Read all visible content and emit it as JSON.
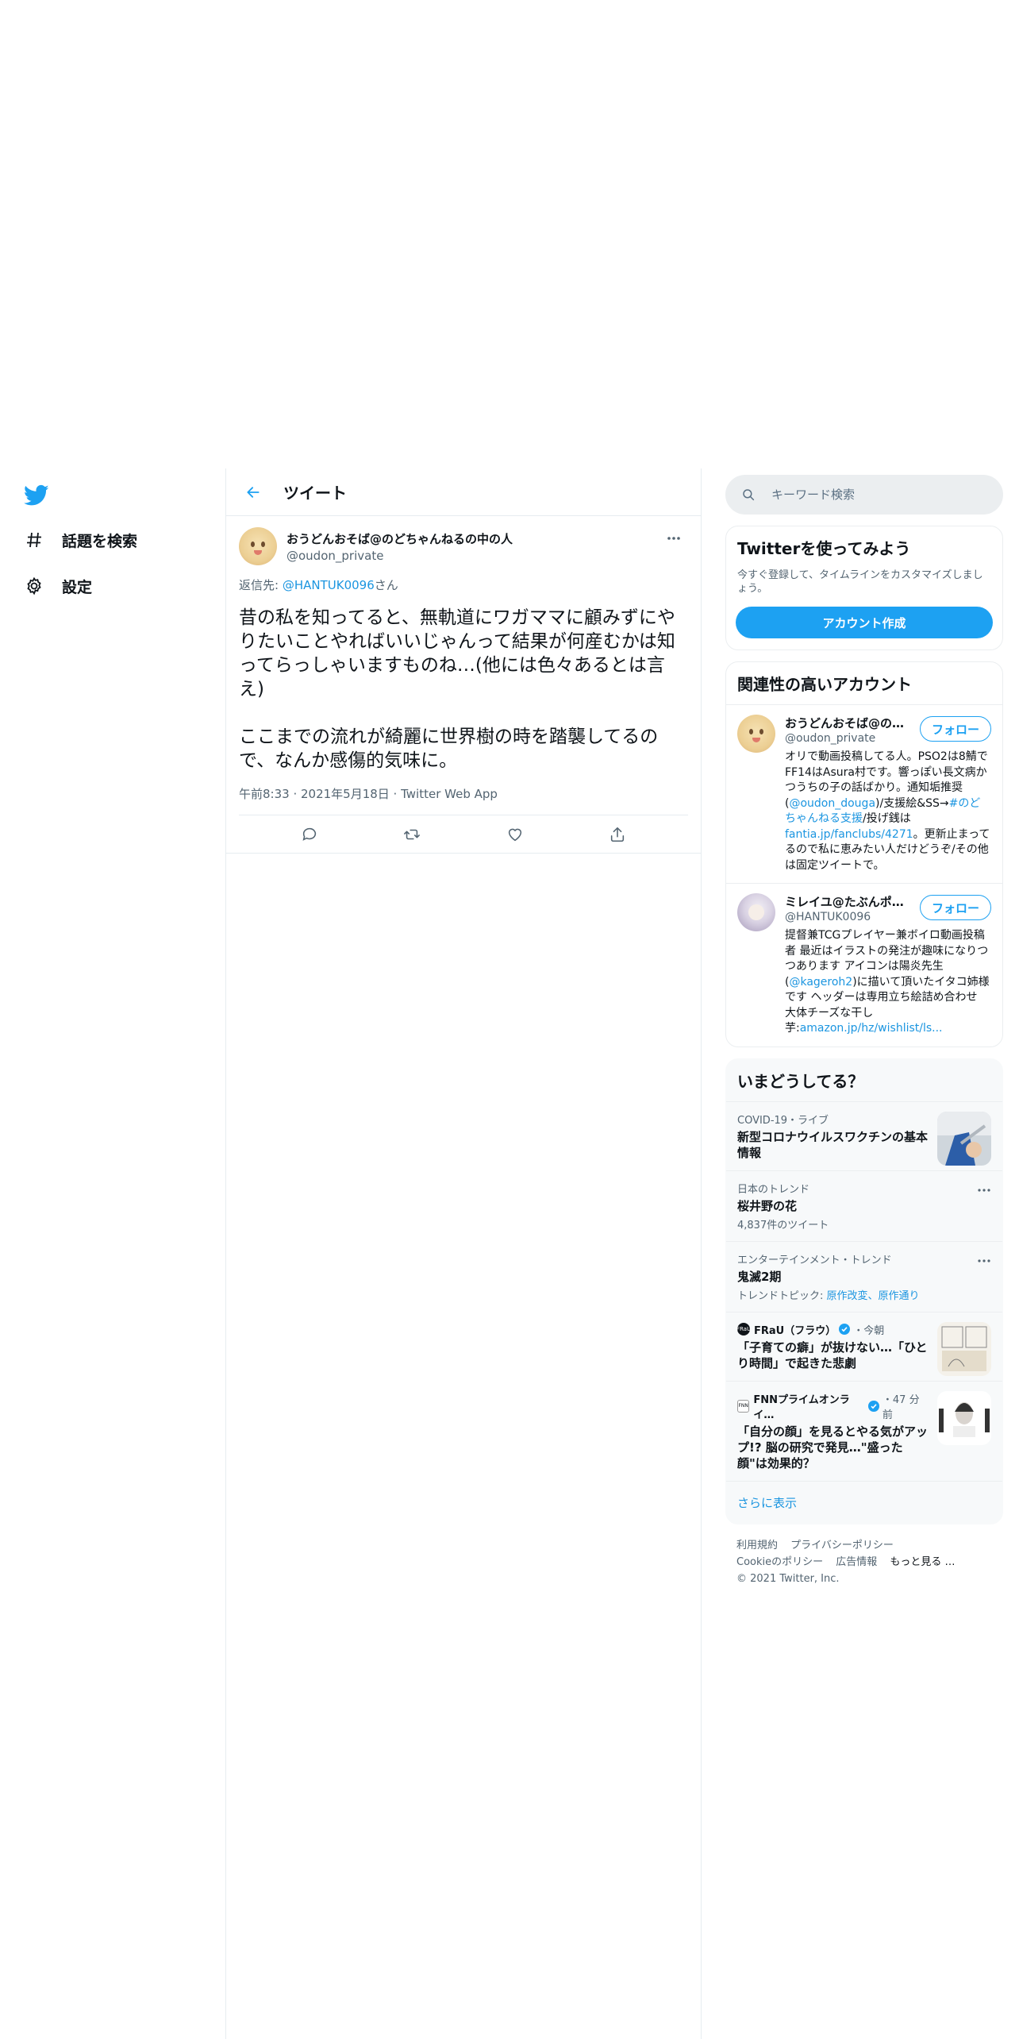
{
  "nav": {
    "items": [
      {
        "label": "話題を検索",
        "icon": "hashtag-icon"
      },
      {
        "label": "設定",
        "icon": "gear-icon"
      }
    ]
  },
  "header": {
    "title": "ツイート"
  },
  "tweet": {
    "author_name": "おうどんおそば@のどちゃんねるの中の人",
    "author_handle": "@oudon_private",
    "reply_prefix": "返信先: ",
    "reply_mention": "@HANTUK0096",
    "reply_suffix": "さん",
    "text": "昔の私を知ってると、無軌道にワガママに顧みずにやりたいことやればいいじゃんって結果が何産むかは知ってらっしゃいますものね…(他には色々あるとは言え)\n\nここまでの流れが綺麗に世界樹の時を踏襲してるので、なんか感傷的気味に。",
    "meta": "午前8:33 · 2021年5月18日 · Twitter Web App"
  },
  "search": {
    "placeholder": "キーワード検索"
  },
  "signup": {
    "title": "Twitterを使ってみよう",
    "subtitle": "今すぐ登録して、タイムラインをカスタマイズしましょう。",
    "button": "アカウント作成"
  },
  "related": {
    "title": "関連性の高いアカウント",
    "follow_label": "フォロー",
    "accounts": [
      {
        "name": "おうどんおそば@の…",
        "handle": "@oudon_private",
        "bio_1": "オリで動画投稿してる人。PSO2は8鯖でFF14はAsura村です。響っぽい長文病かつうちの子の話ばかり。通知垢推奨(",
        "bio_link_1": "@oudon_douga",
        "bio_2": ")/支援絵&SS→",
        "bio_link_2": "#のどちゃんねる支援",
        "bio_3": "/投げ銭は",
        "bio_link_3": "fantia.jp/fanclubs/4271",
        "bio_4": "。更新止まってるので私に恵みたい人だけどうぞ/その他は固定ツイートで。"
      },
      {
        "name": "ミレイユ@たぶんポ…",
        "handle": "@HANTUK0096",
        "bio_1": "提督兼TCGプレイヤー兼ボイロ動画投稿者 最近はイラストの発注が趣味になりつつあります アイコンは陽炎先生(",
        "bio_link_1": "@kageroh2",
        "bio_2": ")に描いて頂いたイタコ姉様です ヘッダーは専用立ち絵詰め合わせ 大体チーズな干し芋:",
        "bio_link_2": "amazon.jp/hz/wishlist/ls..."
      }
    ]
  },
  "trends": {
    "title": "いまどうしてる？",
    "items": [
      {
        "category": "COVID-19・ライブ",
        "title": "新型コロナウイルスワクチンの基本情報"
      },
      {
        "category": "日本のトレンド",
        "title": "桜井野の花",
        "count": "4,837件のツイート"
      },
      {
        "category": "エンターテインメント・トレンド",
        "title": "鬼滅2期",
        "count_prefix": "トレンドトピック: ",
        "count_links": "原作改変、原作通り"
      },
      {
        "source": "FRaU（フラウ）",
        "source_badge": "FRaU",
        "time": "・今朝",
        "title": "「子育ての癖」が抜けない…「ひとり時間」で起きた悲劇"
      },
      {
        "source": "FNNプライムオンライ…",
        "source_badge": "FNN",
        "time": "・47 分前",
        "title": "「自分の顔」を見るとやる気がアップ!? 脳の研究で発見…\"盛った顔\"は効果的？"
      }
    ],
    "show_more": "さらに表示"
  },
  "footer": {
    "links": [
      "利用規約",
      "プライバシーポリシー",
      "Cookieのポリシー",
      "広告情報",
      "もっと見る …"
    ],
    "copyright": "© 2021 Twitter, Inc."
  },
  "colors": {
    "accent": "#1da1f2",
    "link": "#1b95e0",
    "text": "#0f1419",
    "muted": "#536471"
  }
}
